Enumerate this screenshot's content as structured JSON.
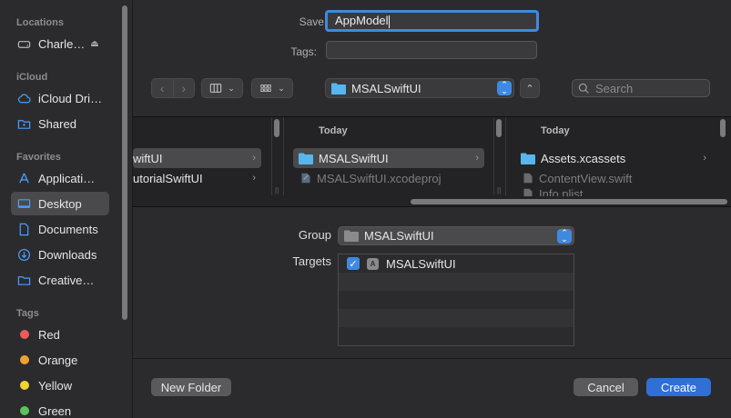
{
  "sidebar": {
    "sections": {
      "locations": "Locations",
      "icloud": "iCloud",
      "favorites": "Favorites",
      "tags": "Tags"
    },
    "locations": [
      {
        "label": "Charle…",
        "icon": "drive-icon"
      }
    ],
    "icloud": [
      {
        "label": "iCloud Dri…",
        "icon": "cloud-icon"
      },
      {
        "label": "Shared",
        "icon": "shared-folder-icon"
      }
    ],
    "favorites": [
      {
        "label": "Applicati…",
        "icon": "applications-icon"
      },
      {
        "label": "Desktop",
        "icon": "desktop-icon",
        "selected": true
      },
      {
        "label": "Documents",
        "icon": "document-icon"
      },
      {
        "label": "Downloads",
        "icon": "download-icon"
      },
      {
        "label": "Creative…",
        "icon": "folder-icon"
      }
    ],
    "tags": [
      {
        "label": "Red",
        "color": "#ec5b5b"
      },
      {
        "label": "Orange",
        "color": "#f0a030"
      },
      {
        "label": "Yellow",
        "color": "#f2d431"
      },
      {
        "label": "Green",
        "color": "#5ac45a"
      }
    ]
  },
  "form": {
    "save_as_label": "Save As:",
    "save_as_value": "AppModel",
    "tags_label": "Tags:",
    "tags_value": ""
  },
  "toolbar": {
    "location": "MSALSwiftUI",
    "search_placeholder": "Search"
  },
  "browser": {
    "columns": [
      {
        "header": "",
        "rows": [
          {
            "label": "wiftUI",
            "selected": true,
            "chevron": true
          },
          {
            "label": "utorialSwiftUI",
            "chevron": true
          }
        ]
      },
      {
        "header": "Today",
        "rows": [
          {
            "label": "MSALSwiftUI",
            "selected": true,
            "chevron": true,
            "icon": "folder"
          },
          {
            "label": "MSALSwiftUI.xcodeproj",
            "dim": true,
            "icon": "xcodeproj"
          }
        ]
      },
      {
        "header": "Today",
        "rows": [
          {
            "label": "Assets.xcassets",
            "chevron": true,
            "icon": "folder"
          },
          {
            "label": "ContentView.swift",
            "dim": true,
            "icon": "file"
          },
          {
            "label": "Info.plist",
            "dim": true,
            "icon": "file"
          }
        ]
      }
    ]
  },
  "group": {
    "label": "Group",
    "value": "MSALSwiftUI"
  },
  "targets": {
    "label": "Targets",
    "items": [
      {
        "label": "MSALSwiftUI",
        "checked": true
      }
    ]
  },
  "buttons": {
    "new_folder": "New Folder",
    "cancel": "Cancel",
    "create": "Create"
  },
  "colors": {
    "accent": "#3f8ae0",
    "primary_button": "#2f6fd6"
  }
}
